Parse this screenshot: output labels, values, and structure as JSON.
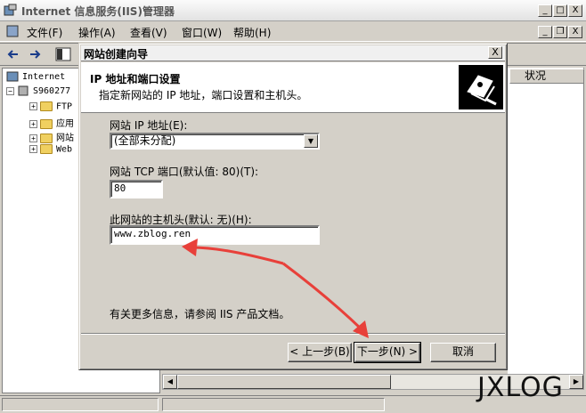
{
  "window": {
    "title": "Internet 信息服务(IIS)管理器",
    "minimize": "_",
    "maximize": "□",
    "close": "X"
  },
  "menu": {
    "items": [
      "文件(F)",
      "操作(A)",
      "查看(V)",
      "窗口(W)",
      "帮助(H)"
    ]
  },
  "tree": {
    "root": "Internet",
    "server": "S960277",
    "nodes": [
      "FTP",
      "应用",
      "网站",
      "Web"
    ]
  },
  "list": {
    "status_header": "状况"
  },
  "dialog": {
    "title": "网站创建向导",
    "close": "X",
    "heading": "IP 地址和端口设置",
    "subheading": "指定新网站的 IP 地址，端口设置和主机头。",
    "ip_label": "网站 IP 地址(E):",
    "ip_value": "(全部未分配)",
    "port_label": "网站 TCP 端口(默认值: 80)(T):",
    "port_value": "80",
    "host_label": "此网站的主机头(默认: 无)(H):",
    "host_value": "www.zblog.ren",
    "info_text": "有关更多信息，请参阅 IIS 产品文档。",
    "back_button": "< 上一步(B)",
    "next_button": "下一步(N) >",
    "cancel_button": "取消"
  },
  "watermark": "JXLOG",
  "colors": {
    "annotation_arrow": "#e8403a",
    "chrome": "#d4d0c8"
  }
}
